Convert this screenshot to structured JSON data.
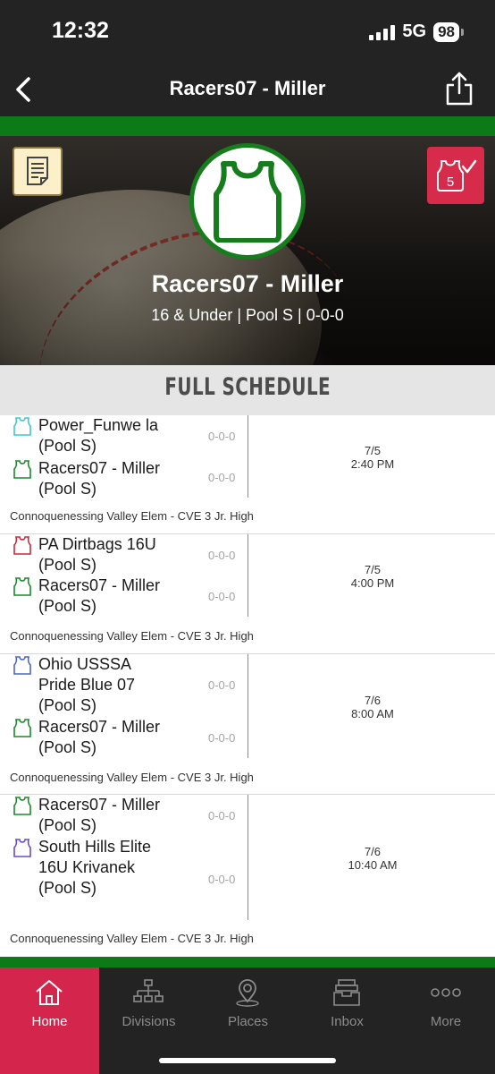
{
  "status_bar": {
    "time": "12:32",
    "network": "5G",
    "battery": "98"
  },
  "nav": {
    "title": "Racers07 - Miller",
    "back_icon": "chevron-left-icon",
    "share_icon": "share-icon"
  },
  "hero": {
    "team_name": "Racers07 - Miller",
    "info": "16 & Under | Pool S | 0-0-0",
    "notes_icon": "notes-icon",
    "roster_badge": "5"
  },
  "schedule": {
    "title": "FULL SCHEDULE",
    "games": [
      {
        "teams": [
          {
            "name": "Power_Funwe la (Pool S)",
            "record": "0-0-0",
            "jersey_color": "#3cc6d6"
          },
          {
            "name": "Racers07 - Miller (Pool S)",
            "record": "0-0-0",
            "jersey_color": "#1a8a2a"
          }
        ],
        "date": "7/5",
        "time": "2:40 PM",
        "location": "Connoquenessing Valley Elem - CVE 3 Jr. High"
      },
      {
        "teams": [
          {
            "name": "PA Dirtbags 16U (Pool S)",
            "record": "0-0-0",
            "jersey_color": "#c8283c"
          },
          {
            "name": "Racers07 - Miller (Pool S)",
            "record": "0-0-0",
            "jersey_color": "#1a8a2a"
          }
        ],
        "date": "7/5",
        "time": "4:00 PM",
        "location": "Connoquenessing Valley Elem - CVE 3 Jr. High"
      },
      {
        "teams": [
          {
            "name": "Ohio USSSA Pride Blue 07 (Pool S)",
            "record": "0-0-0",
            "jersey_color": "#4a66c8"
          },
          {
            "name": "Racers07 - Miller (Pool S)",
            "record": "0-0-0",
            "jersey_color": "#1a8a2a"
          }
        ],
        "date": "7/6",
        "time": "8:00 AM",
        "location": "Connoquenessing Valley Elem - CVE 3 Jr. High"
      },
      {
        "teams": [
          {
            "name": "Racers07 - Miller (Pool S)",
            "record": "0-0-0",
            "jersey_color": "#1a8a2a"
          },
          {
            "name": "South Hills Elite 16U Krivanek (Pool S)",
            "record": "0-0-0",
            "jersey_color": "#6a4ac8"
          }
        ],
        "date": "7/6",
        "time": "10:40 AM",
        "location": "Connoquenessing Valley Elem - CVE 3 Jr. High"
      }
    ]
  },
  "tabs": [
    {
      "label": "Home",
      "icon": "home-icon",
      "active": true
    },
    {
      "label": "Divisions",
      "icon": "divisions-icon",
      "active": false
    },
    {
      "label": "Places",
      "icon": "places-icon",
      "active": false
    },
    {
      "label": "Inbox",
      "icon": "inbox-icon",
      "active": false
    },
    {
      "label": "More",
      "icon": "more-icon",
      "active": false
    }
  ],
  "colors": {
    "brand_green": "#0b7a17",
    "accent_red": "#d4264c",
    "bar_dark": "#232323"
  }
}
